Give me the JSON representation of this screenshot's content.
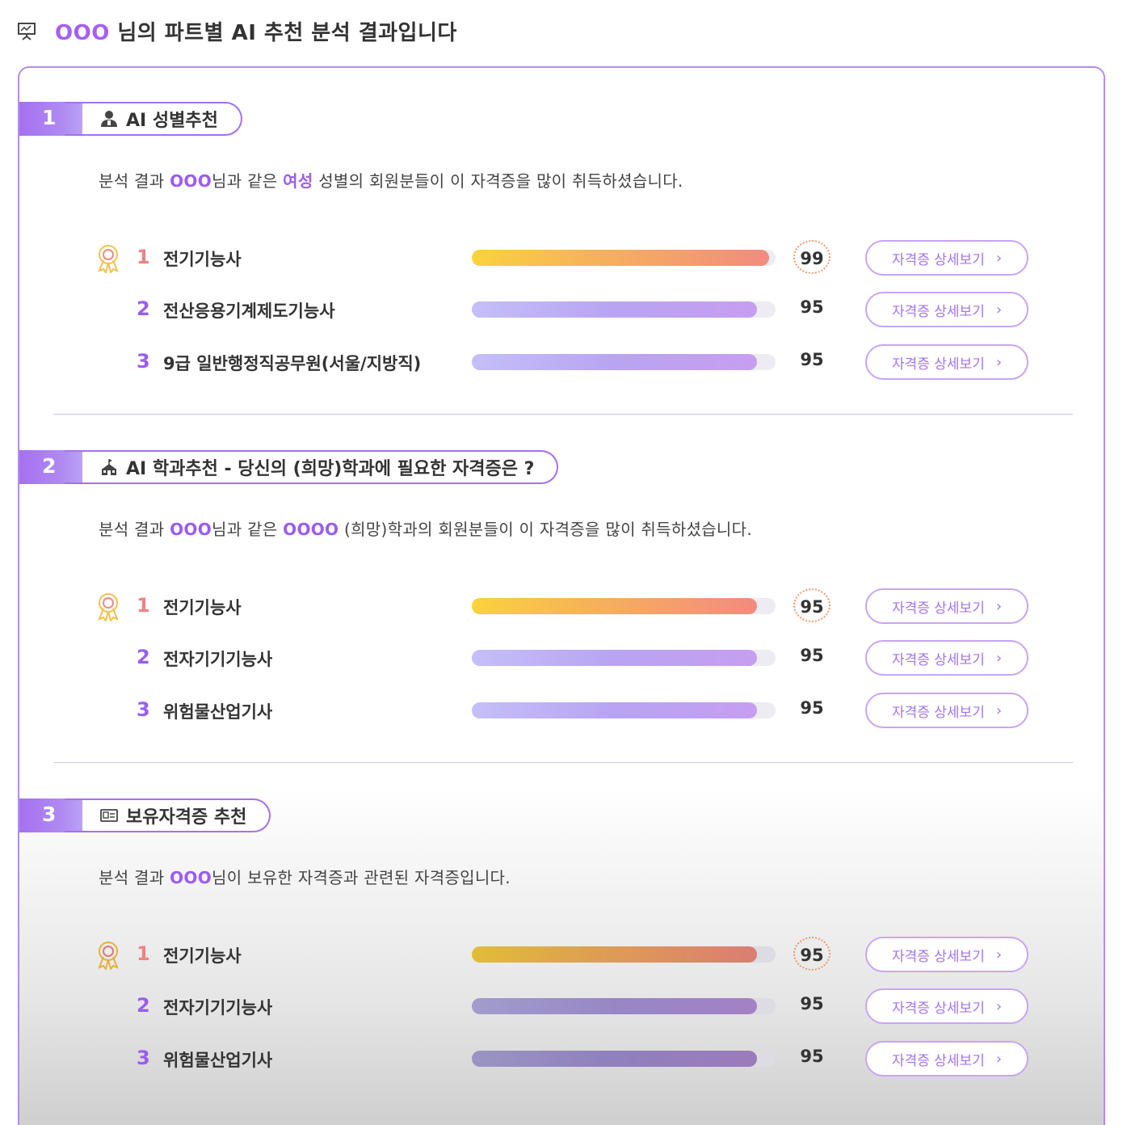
{
  "header": {
    "icon": "presentation-icon",
    "title_highlight": "OOO",
    "title_rest": " 님의 파트별 AI 추천 분석 결과입니다"
  },
  "colors": {
    "accent": "#a470ef",
    "highlight": "#9b5cf0",
    "gold_rank": "#ee8383"
  },
  "sections": [
    {
      "number": "1",
      "icon": "person-icon",
      "title": "AI 성별추천",
      "desc": {
        "p1": "분석 결과 ",
        "h1": "OOO",
        "p2": "님과 같은 ",
        "h2": "여성",
        "p3": " 성별의 회원분들이 이 자격증을 많이 취득하셨습니다."
      },
      "items": [
        {
          "rank": "1",
          "name": "전기기능사",
          "score": "99",
          "bar": 0.98,
          "button": "자격증 상세보기"
        },
        {
          "rank": "2",
          "name": "전산응용기계제도기능사",
          "score": "95",
          "bar": 0.94,
          "button": "자격증 상세보기"
        },
        {
          "rank": "3",
          "name": "9급 일반행정직공무원(서울/지방직)",
          "score": "95",
          "bar": 0.94,
          "button": "자격증 상세보기"
        }
      ]
    },
    {
      "number": "2",
      "icon": "school-icon",
      "title": "AI 학과추천 - 당신의 (희망)학과에 필요한 자격증은 ?",
      "desc": {
        "p1": "분석 결과 ",
        "h1": "OOO",
        "p2": "님과 같은 ",
        "h2": "OOOO",
        "p3": " (희망)학과의 회원분들이 이 자격증을 많이 취득하셨습니다."
      },
      "items": [
        {
          "rank": "1",
          "name": "전기기능사",
          "score": "95",
          "bar": 0.94,
          "button": "자격증 상세보기"
        },
        {
          "rank": "2",
          "name": "전자기기기능사",
          "score": "95",
          "bar": 0.94,
          "button": "자격증 상세보기"
        },
        {
          "rank": "3",
          "name": "위험물산업기사",
          "score": "95",
          "bar": 0.94,
          "button": "자격증 상세보기"
        }
      ]
    },
    {
      "number": "3",
      "icon": "id-card-icon",
      "title": "보유자격증 추천",
      "desc": {
        "p1": "분석 결과 ",
        "h1": "OOO",
        "p2": "님이 보유한 자격증과 관련된 자격증입니다.",
        "h2": "",
        "p3": ""
      },
      "items": [
        {
          "rank": "1",
          "name": "전기기능사",
          "score": "95",
          "bar": 0.94,
          "button": "자격증 상세보기"
        },
        {
          "rank": "2",
          "name": "전자기기기능사",
          "score": "95",
          "bar": 0.94,
          "button": "자격증 상세보기"
        },
        {
          "rank": "3",
          "name": "위험물산업기사",
          "score": "95",
          "bar": 0.94,
          "button": "자격증 상세보기"
        }
      ]
    }
  ]
}
